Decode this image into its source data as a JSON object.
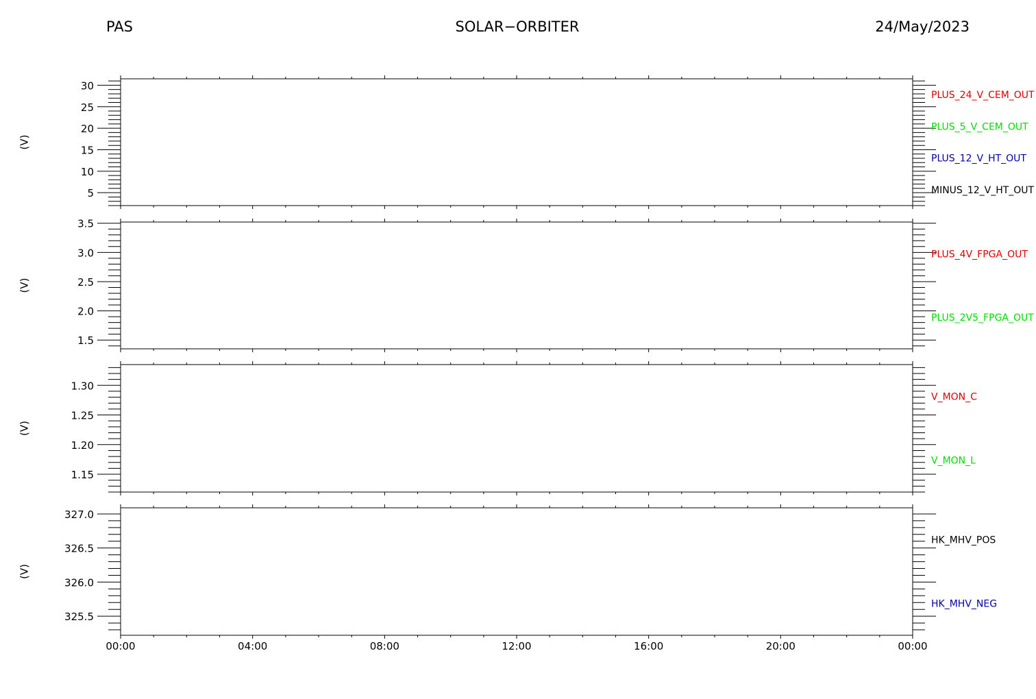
{
  "header": {
    "left": "PAS",
    "center": "SOLAR−ORBITER",
    "right": "24/May/2023"
  },
  "chart_data": [
    {
      "type": "line",
      "ylabel": "(V)",
      "ylim": [
        2,
        31.5
      ],
      "yticks": [
        5,
        10,
        15,
        20,
        25,
        30
      ],
      "ytick_labels": [
        "5",
        "10",
        "15",
        "20",
        "25",
        "30"
      ],
      "series": [
        {
          "name": "PLUS_24_V_CEM_OUT",
          "color": "#dd0000",
          "x": [],
          "y": []
        },
        {
          "name": "PLUS_5_V_CEM_OUT",
          "color": "#00dd00",
          "x": [],
          "y": []
        },
        {
          "name": "PLUS_12_V_HT_OUT",
          "color": "#0000aa",
          "x": [],
          "y": []
        },
        {
          "name": "MINUS_12_V_HT_OUT",
          "color": "#000000",
          "x": [],
          "y": []
        }
      ]
    },
    {
      "type": "line",
      "ylabel": "(V)",
      "ylim": [
        1.35,
        3.52
      ],
      "yticks": [
        1.5,
        2.0,
        2.5,
        3.0,
        3.5
      ],
      "ytick_labels": [
        "1.5",
        "2.0",
        "2.5",
        "3.0",
        "3.5"
      ],
      "series": [
        {
          "name": "PLUS_4V_FPGA_OUT",
          "color": "#dd0000",
          "x": [],
          "y": []
        },
        {
          "name": "PLUS_2V5_FPGA_OUT",
          "color": "#00dd00",
          "x": [],
          "y": []
        }
      ]
    },
    {
      "type": "line",
      "ylabel": "(V)",
      "ylim": [
        1.12,
        1.335
      ],
      "yticks": [
        1.15,
        1.2,
        1.25,
        1.3
      ],
      "ytick_labels": [
        "1.15",
        "1.20",
        "1.25",
        "1.30"
      ],
      "series": [
        {
          "name": "V_MON_C",
          "color": "#dd0000",
          "x": [],
          "y": []
        },
        {
          "name": "V_MON_L",
          "color": "#00dd00",
          "x": [],
          "y": []
        }
      ]
    },
    {
      "type": "line",
      "ylabel": "(V)",
      "ylim": [
        325.22,
        327.09
      ],
      "yticks": [
        325.5,
        326.0,
        326.5,
        327.0
      ],
      "ytick_labels": [
        "325.5",
        "326.0",
        "326.5",
        "327.0"
      ],
      "series": [
        {
          "name": "HK_MHV_POS",
          "color": "#000000",
          "x": [],
          "y": []
        },
        {
          "name": "HK_MHV_NEG",
          "color": "#0000aa",
          "x": [],
          "y": []
        }
      ]
    }
  ],
  "x_axis": {
    "xlim": [
      "2023-05-24T00:00",
      "2023-05-25T00:00"
    ],
    "tick_hours": [
      0,
      4,
      8,
      12,
      16,
      20,
      24
    ],
    "tick_labels": [
      "00:00",
      "04:00",
      "08:00",
      "12:00",
      "16:00",
      "20:00",
      "00:00"
    ],
    "minor_tick_hours": 1
  }
}
